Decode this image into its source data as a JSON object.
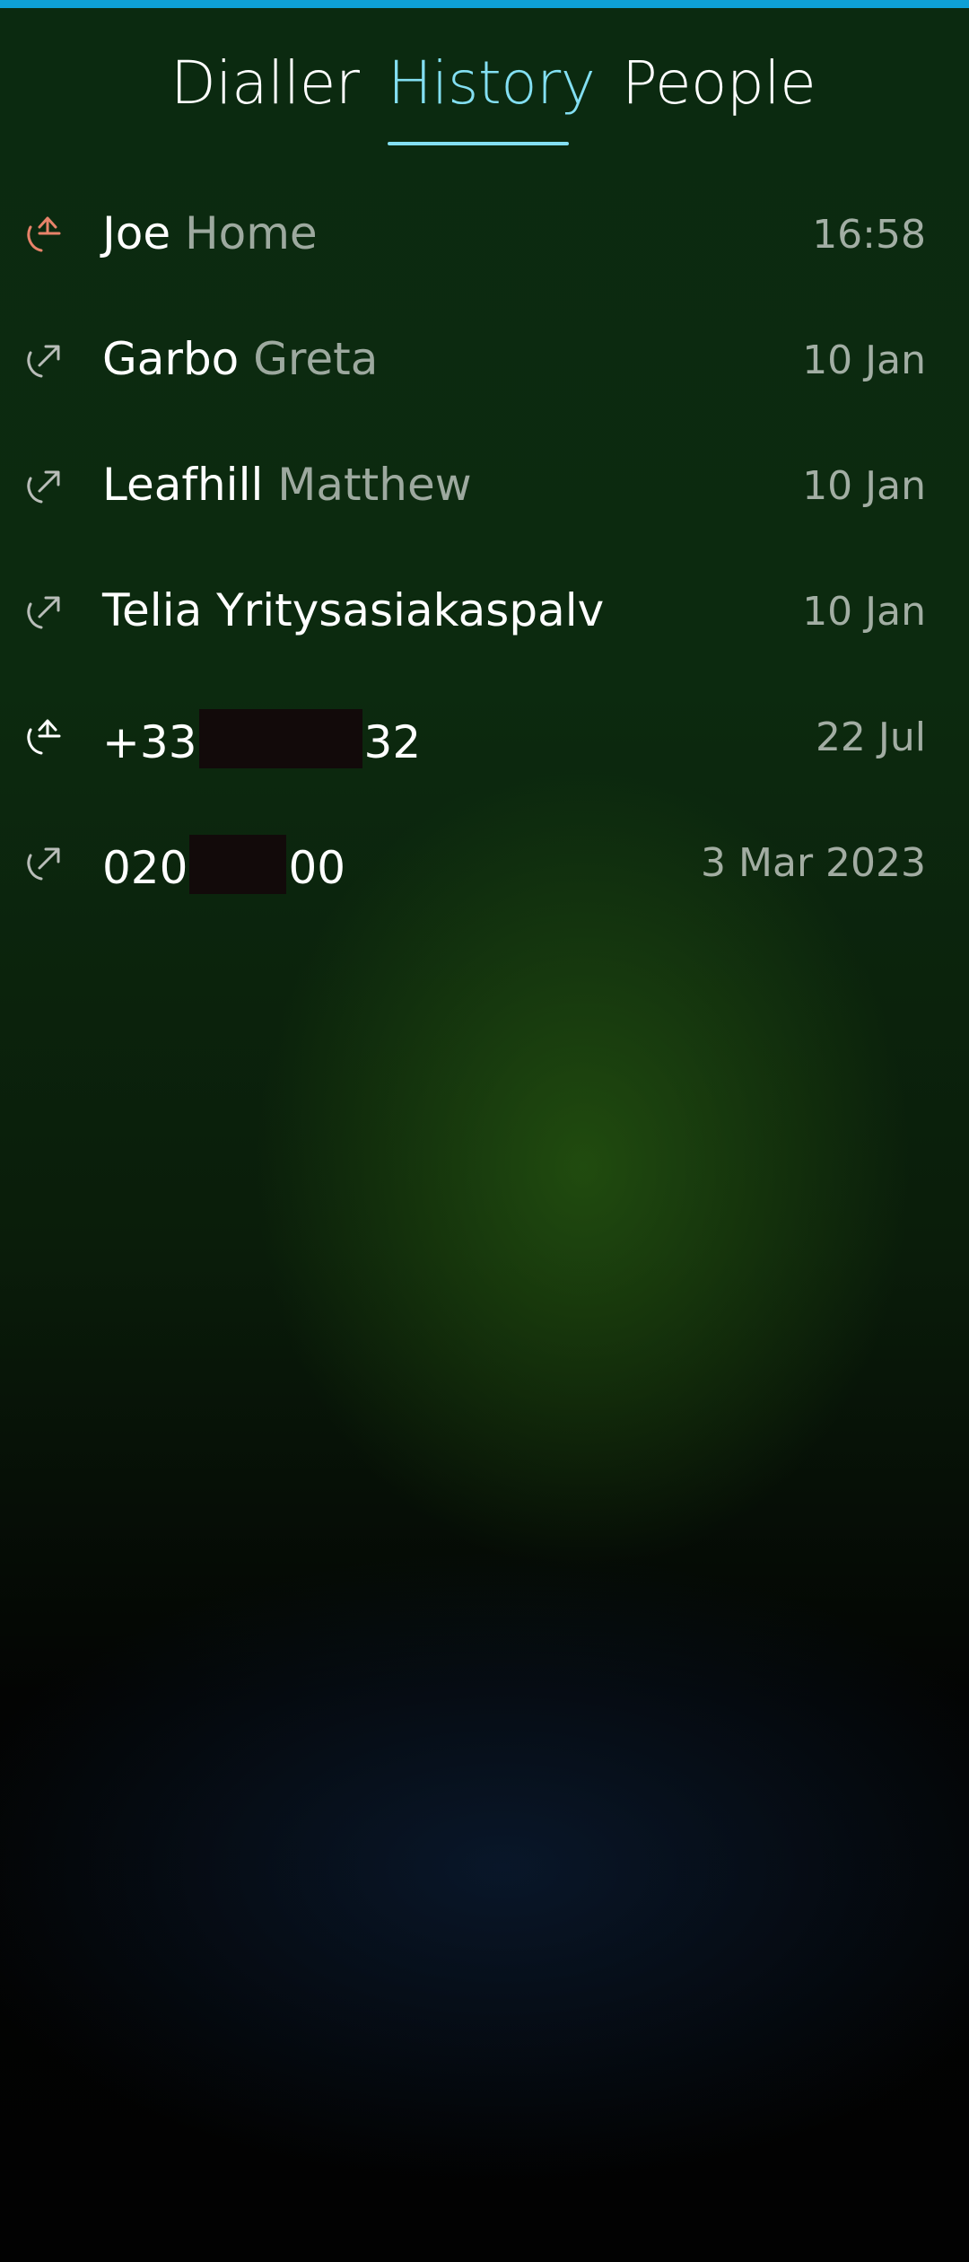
{
  "tabs": {
    "dialler": "Dialler",
    "history": "History",
    "people": "People",
    "active": "History"
  },
  "colors": {
    "accent": "#83dff2",
    "top_strip": "#0ea0d6",
    "missed": "#e8836a",
    "outgoing": "#b9bdb9"
  },
  "calls": [
    {
      "icon": "missed-call-icon",
      "primary": "Joe",
      "secondary": "Home",
      "time": "16:58"
    },
    {
      "icon": "outgoing-call-icon",
      "primary": "Garbo",
      "secondary": "Greta",
      "time": "10 Jan"
    },
    {
      "icon": "outgoing-call-icon",
      "primary": "Leafhill",
      "secondary": "Matthew",
      "time": "10 Jan"
    },
    {
      "icon": "outgoing-call-icon",
      "primary": "Telia Yritysasiakaspalv",
      "secondary": "",
      "time": "10 Jan"
    },
    {
      "icon": "incoming-call-icon",
      "number_start": "+33",
      "number_end": "32",
      "time": "22 Jul"
    },
    {
      "icon": "outgoing-call-icon",
      "number_start": "020",
      "number_end": "00",
      "time": "3 Mar 2023"
    }
  ]
}
